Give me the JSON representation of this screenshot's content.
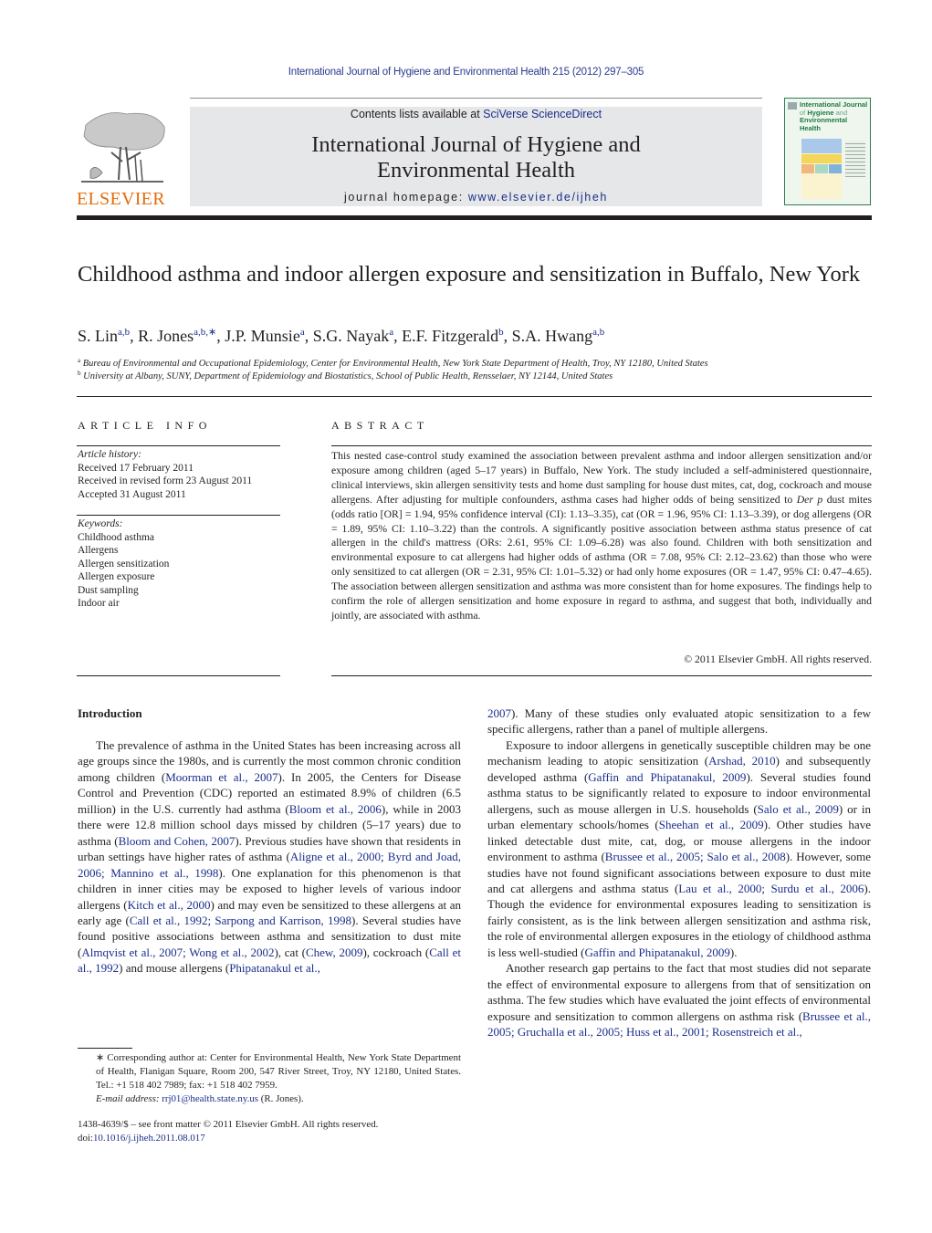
{
  "running_head": "International Journal of Hygiene and Environmental Health 215 (2012) 297–305",
  "masthead": {
    "publisher_logo_text": "ELSEVIER",
    "contents_prefix": "Contents lists available at ",
    "contents_link": "SciVerse ScienceDirect",
    "journal_title_line1": "International Journal of Hygiene and",
    "journal_title_line2": "Environmental Health",
    "homepage_prefix": "journal homepage: ",
    "homepage_link": "www.elsevier.de/ijheh",
    "cover_title_line1": "International Journal",
    "cover_title_line2a": "of ",
    "cover_title_line2b": "Hygiene",
    "cover_title_line2c": " and",
    "cover_title_line3": "Environmental Health"
  },
  "article": {
    "title": "Childhood asthma and indoor allergen exposure and sensitization in Buffalo, New York",
    "authors": [
      {
        "name": "S. Lin",
        "sup": "a,b"
      },
      {
        "name": "R. Jones",
        "sup": "a,b,∗"
      },
      {
        "name": "J.P. Munsie",
        "sup": "a"
      },
      {
        "name": "S.G. Nayak",
        "sup": "a"
      },
      {
        "name": "E.F. Fitzgerald",
        "sup": "b"
      },
      {
        "name": "S.A. Hwang",
        "sup": "a,b"
      }
    ],
    "affiliations": [
      {
        "mark": "a",
        "text": "Bureau of Environmental and Occupational Epidemiology, Center for Environmental Health, New York State Department of Health, Troy, NY 12180, United States"
      },
      {
        "mark": "b",
        "text": "University at Albany, SUNY, Department of Epidemiology and Biostatistics, School of Public Health, Rensselaer, NY 12144, United States"
      }
    ]
  },
  "article_info": {
    "heading": "ARTICLE INFO",
    "history_label": "Article history:",
    "history": [
      "Received 17 February 2011",
      "Received in revised form 23 August 2011",
      "Accepted 31 August 2011"
    ],
    "keywords_label": "Keywords:",
    "keywords": [
      "Childhood asthma",
      "Allergens",
      "Allergen sensitization",
      "Allergen exposure",
      "Dust sampling",
      "Indoor air"
    ]
  },
  "abstract": {
    "heading": "ABSTRACT",
    "text_before_italic": "This nested case-control study examined the association between prevalent asthma and indoor allergen sensitization and/or exposure among children (aged 5–17 years) in Buffalo, New York. The study included a self-administered questionnaire, clinical interviews, skin allergen sensitivity tests and home dust sampling for house dust mites, cat, dog, cockroach and mouse allergens. After adjusting for multiple confounders, asthma cases had higher odds of being sensitized to ",
    "italic": "Der p",
    "text_after_italic": " dust mites (odds ratio [OR] = 1.94, 95% confidence interval (CI): 1.13–3.35), cat (OR = 1.96, 95% CI: 1.13–3.39), or dog allergens (OR = 1.89, 95% CI: 1.10–3.22) than the controls. A significantly positive association between asthma status presence of cat allergen in the child's mattress (ORs: 2.61, 95% CI: 1.09–6.28) was also found. Children with both sensitization and environmental exposure to cat allergens had higher odds of asthma (OR = 7.08, 95% CI: 2.12–23.62) than those who were only sensitized to cat allergen (OR = 2.31, 95% CI: 1.01–5.32) or had only home exposures (OR = 1.47, 95% CI: 0.47–4.65). The association between allergen sensitization and asthma was more consistent than for home exposures. The findings help to confirm the role of allergen sensitization and home exposure in regard to asthma, and suggest that both, individually and jointly, are associated with asthma.",
    "copyright": "© 2011 Elsevier GmbH. All rights reserved."
  },
  "introduction": {
    "heading": "Introduction",
    "left_column": [
      {
        "t": "The prevalence of asthma in the United States has been increasing across all age groups since the 1980s, and is currently the most common chronic condition among children ("
      },
      {
        "l": "Moorman et al., 2007"
      },
      {
        "t": "). In 2005, the Centers for Disease Control and Prevention (CDC) reported an estimated 8.9% of children (6.5 million) in the U.S. currently had asthma ("
      },
      {
        "l": "Bloom et al., 2006"
      },
      {
        "t": "), while in 2003 there were 12.8 million school days missed by children (5–17 years) due to asthma ("
      },
      {
        "l": "Bloom and Cohen, 2007"
      },
      {
        "t": "). Previous studies have shown that residents in urban settings have higher rates of asthma ("
      },
      {
        "l": "Aligne et al., 2000; Byrd and Joad, 2006; Mannino et al., 1998"
      },
      {
        "t": "). One explanation for this phenomenon is that children in inner cities may be exposed to higher levels of various indoor allergens ("
      },
      {
        "l": "Kitch et al., 2000"
      },
      {
        "t": ") and may even be sensitized to these allergens at an early age ("
      },
      {
        "l": "Call et al., 1992; Sarpong and Karrison, 1998"
      },
      {
        "t": "). Several studies have found positive associations between asthma and sensitization to dust mite ("
      },
      {
        "l": "Almqvist et al., 2007; Wong et al., 2002"
      },
      {
        "t": "), cat ("
      },
      {
        "l": "Chew, 2009"
      },
      {
        "t": "), cockroach ("
      },
      {
        "l": "Call et al., 1992"
      },
      {
        "t": ") and mouse allergens ("
      },
      {
        "l": "Phipatanakul et al.,"
      }
    ],
    "right_column_p1": [
      {
        "l": "2007"
      },
      {
        "t": "). Many of these studies only evaluated atopic sensitization to a few specific allergens, rather than a panel of multiple allergens."
      }
    ],
    "right_column_p2": [
      {
        "t": "Exposure to indoor allergens in genetically susceptible children may be one mechanism leading to atopic sensitization ("
      },
      {
        "l": "Arshad, 2010"
      },
      {
        "t": ") and subsequently developed asthma ("
      },
      {
        "l": "Gaffin and Phipatanakul, 2009"
      },
      {
        "t": "). Several studies found asthma status to be significantly related to exposure to indoor environmental allergens, such as mouse allergen in U.S. households ("
      },
      {
        "l": "Salo et al., 2009"
      },
      {
        "t": ") or in urban elementary schools/homes ("
      },
      {
        "l": "Sheehan et al., 2009"
      },
      {
        "t": "). Other studies have linked detectable dust mite, cat, dog, or mouse allergens in the indoor environment to asthma ("
      },
      {
        "l": "Brussee et al., 2005; Salo et al., 2008"
      },
      {
        "t": "). However, some studies have not found significant associations between exposure to dust mite and cat allergens and asthma status ("
      },
      {
        "l": "Lau et al., 2000; Surdu et al., 2006"
      },
      {
        "t": "). Though the evidence for environmental exposures leading to sensitization is fairly consistent, as is the link between allergen sensitization and asthma risk, the role of environmental allergen exposures in the etiology of childhood asthma is less well-studied ("
      },
      {
        "l": "Gaffin and Phipatanakul, 2009"
      },
      {
        "t": ")."
      }
    ],
    "right_column_p3": [
      {
        "t": "Another research gap pertains to the fact that most studies did not separate the effect of environmental exposure to allergens from that of sensitization on asthma. The few studies which have evaluated the joint effects of environmental exposure and sensitization to common allergens on asthma risk ("
      },
      {
        "l": "Brussee et al., 2005; Gruchalla et al., 2005; Huss et al., 2001; Rosenstreich et al.,"
      }
    ]
  },
  "footnote": {
    "corresponding": "∗ Corresponding author at: Center for Environmental Health, New York State Department of Health, Flanigan Square, Room 200, 547 River Street, Troy, NY 12180, United States. Tel.: +1 518 402 7989; fax: +1 518 402 7959.",
    "email_label": "E-mail address: ",
    "email": "rrj01@health.state.ny.us",
    "email_suffix": " (R. Jones).",
    "front_matter": "1438-4639/$ – see front matter © 2011 Elsevier GmbH. All rights reserved.",
    "doi_prefix": "doi:",
    "doi": "10.1016/j.ijheh.2011.08.017"
  },
  "colors": {
    "link": "#1a2e8a",
    "elsevier_orange": "#e36c0a",
    "masthead_gray": "#e6e7e8",
    "cover_green": "#1e7a45"
  }
}
